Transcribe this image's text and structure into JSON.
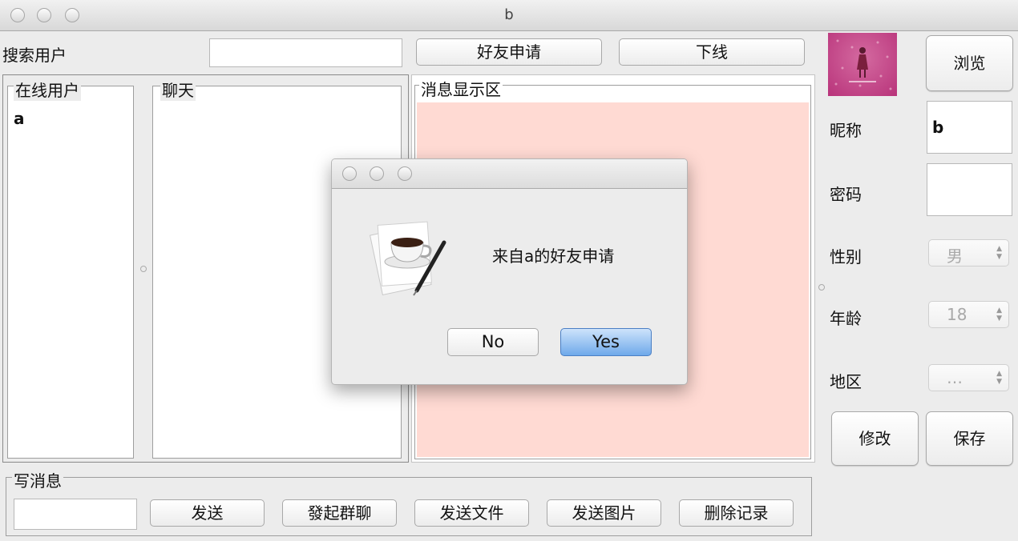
{
  "window": {
    "title": "b"
  },
  "toolbar": {
    "search_label": "搜索用户",
    "search_value": "",
    "friend_request_button": "好友申请",
    "logout_button": "下线"
  },
  "online_users": {
    "title": "在线用户",
    "items": [
      "a"
    ]
  },
  "chat": {
    "title": "聊天"
  },
  "messages": {
    "title": "消息显示区",
    "bg_color": "#ffdad3"
  },
  "profile": {
    "browse_button": "浏览",
    "nickname_label": "昵称",
    "nickname_value": "b",
    "password_label": "密码",
    "password_value": "",
    "gender_label": "性别",
    "gender_value": "男",
    "age_label": "年龄",
    "age_value": "18",
    "region_label": "地区",
    "region_value": "…",
    "modify_button": "修改",
    "save_button": "保存"
  },
  "compose": {
    "title": "写消息",
    "input_value": "",
    "send_button": "发送",
    "group_chat_button": "發起群聊",
    "send_file_button": "发送文件",
    "send_image_button": "发送图片",
    "delete_history_button": "删除记录"
  },
  "dialog": {
    "message": "来自a的好友申请",
    "no_button": "No",
    "yes_button": "Yes"
  }
}
